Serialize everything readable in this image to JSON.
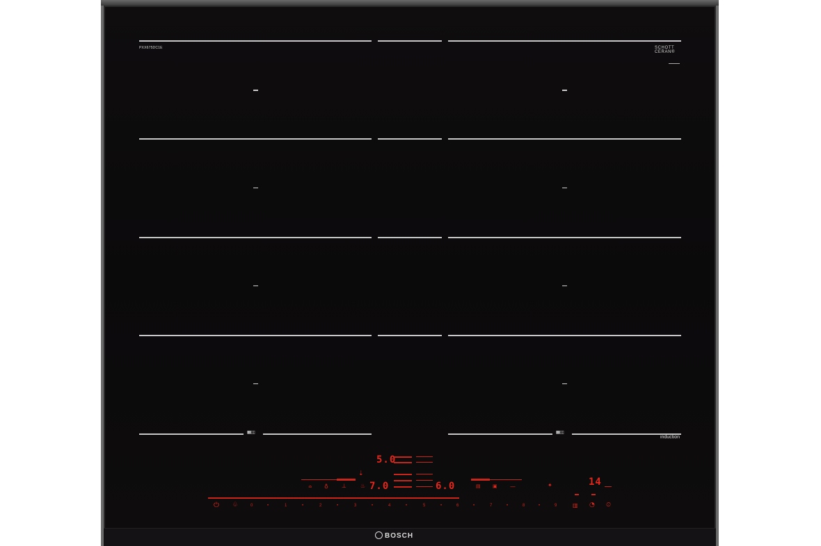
{
  "model_label": "PXX675DC1E",
  "badge": {
    "line1": "SCHOTT",
    "line2": "CERAN®"
  },
  "cooktop_type_label": "induction",
  "brand": "BOSCH",
  "flex_icon_glyph": "▮▮▯▯",
  "displays": {
    "top_value": "5.0",
    "center_value": "7.0",
    "right_value": "6.0",
    "timer_value": "14"
  },
  "power_scale": [
    "0",
    "•",
    "1",
    "•",
    "2",
    "•",
    "3",
    "•",
    "4",
    "•",
    "5",
    "•",
    "6",
    "•",
    "7",
    "•",
    "8",
    "•",
    "9"
  ],
  "icons": {
    "power": "power-icon",
    "child_lock": "child-lock-icon",
    "wipe_protection": "wipe-protection-icon",
    "timer": "timer-icon",
    "boost": "boost-icon",
    "frying_sensor": "frying-sensor-icon",
    "move_mode": "move-mode-icon",
    "keep_warm": "keep-warm-icon"
  },
  "colors": {
    "glass": "#0d0b0c",
    "red_display": "#e3271c",
    "zone_lines": "#c8c8c8"
  }
}
